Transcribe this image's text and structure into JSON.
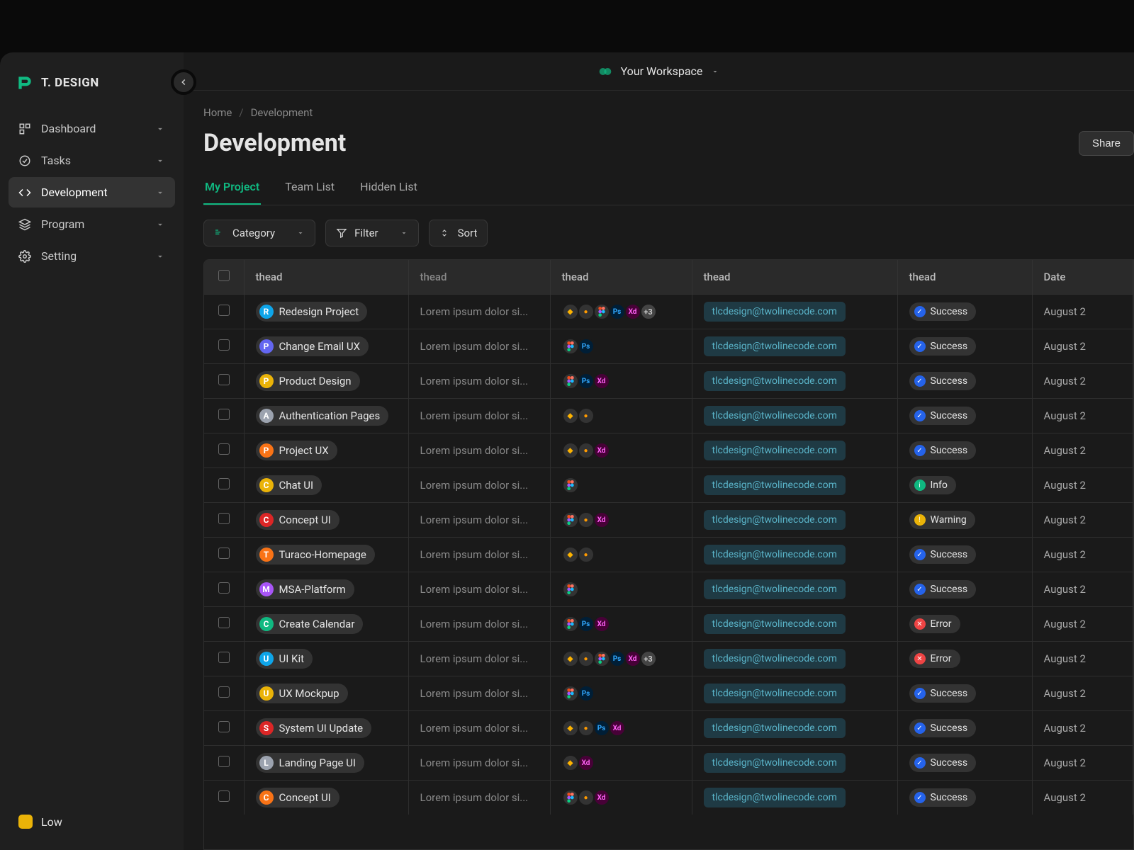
{
  "brand": {
    "name": "T. DESIGN"
  },
  "sidebar": {
    "items": [
      {
        "label": "Dashboard",
        "icon": "dashboard"
      },
      {
        "label": "Tasks",
        "icon": "tasks"
      },
      {
        "label": "Development",
        "icon": "code",
        "active": true
      },
      {
        "label": "Program",
        "icon": "layers"
      },
      {
        "label": "Setting",
        "icon": "gear"
      }
    ],
    "footer_label": "Low"
  },
  "workspace": {
    "label": "Your Workspace"
  },
  "breadcrumb": {
    "home": "Home",
    "current": "Development"
  },
  "page": {
    "title": "Development",
    "share": "Share"
  },
  "tabs": [
    {
      "label": "My Project",
      "active": true
    },
    {
      "label": "Team List"
    },
    {
      "label": "Hidden List"
    }
  ],
  "toolbar": {
    "category": "Category",
    "filter": "Filter",
    "sort": "Sort"
  },
  "columns": [
    "thead",
    "thead",
    "thead",
    "thead",
    "thead",
    "Date"
  ],
  "email": "tlcdesign@twolinecode.com",
  "desc": "Lorem ipsum dolor si...",
  "date": "August 2",
  "statuses": {
    "success": "Success",
    "info": "Info",
    "warning": "Warning",
    "error": "Error"
  },
  "rows": [
    {
      "letter": "R",
      "color": "#0ea5e9",
      "name": "Redesign Project",
      "apps": [
        "sketch",
        "ai",
        "figma",
        "ps",
        "xd"
      ],
      "more": "+3",
      "status": "success"
    },
    {
      "letter": "P",
      "color": "#6366f1",
      "name": "Change Email UX",
      "apps": [
        "figma",
        "ps"
      ],
      "status": "success"
    },
    {
      "letter": "P",
      "color": "#eab308",
      "name": "Product Design",
      "apps": [
        "figma",
        "ps",
        "xd"
      ],
      "status": "success"
    },
    {
      "letter": "A",
      "color": "#9ca3af",
      "name": "Authentication Pages",
      "apps": [
        "sketch",
        "ai"
      ],
      "status": "success"
    },
    {
      "letter": "P",
      "color": "#f97316",
      "name": "Project UX",
      "apps": [
        "sketch",
        "ai",
        "xd"
      ],
      "status": "success"
    },
    {
      "letter": "C",
      "color": "#eab308",
      "name": "Chat UI",
      "apps": [
        "figma"
      ],
      "status": "info"
    },
    {
      "letter": "C",
      "color": "#dc2626",
      "name": "Concept UI",
      "apps": [
        "figma",
        "ai",
        "xd"
      ],
      "status": "warning"
    },
    {
      "letter": "T",
      "color": "#f97316",
      "name": "Turaco-Homepage",
      "apps": [
        "sketch",
        "ai"
      ],
      "status": "success"
    },
    {
      "letter": "M",
      "color": "#a855f7",
      "name": "MSA-Platform",
      "apps": [
        "figma"
      ],
      "status": "success"
    },
    {
      "letter": "C",
      "color": "#10b981",
      "name": "Create Calendar",
      "apps": [
        "figma",
        "ps",
        "xd"
      ],
      "status": "error"
    },
    {
      "letter": "U",
      "color": "#0ea5e9",
      "name": "UI Kit",
      "apps": [
        "sketch",
        "ai",
        "figma",
        "ps",
        "xd"
      ],
      "more": "+3",
      "status": "error"
    },
    {
      "letter": "U",
      "color": "#eab308",
      "name": "UX Mockpup",
      "apps": [
        "figma",
        "ps"
      ],
      "status": "success"
    },
    {
      "letter": "S",
      "color": "#dc2626",
      "name": "System UI Update",
      "apps": [
        "sketch",
        "ai",
        "ps",
        "xd"
      ],
      "status": "success"
    },
    {
      "letter": "L",
      "color": "#9ca3af",
      "name": "Landing Page UI",
      "apps": [
        "sketch",
        "xd"
      ],
      "status": "success"
    },
    {
      "letter": "C",
      "color": "#f97316",
      "name": "Concept UI",
      "apps": [
        "figma",
        "ai",
        "xd"
      ],
      "status": "success"
    }
  ]
}
